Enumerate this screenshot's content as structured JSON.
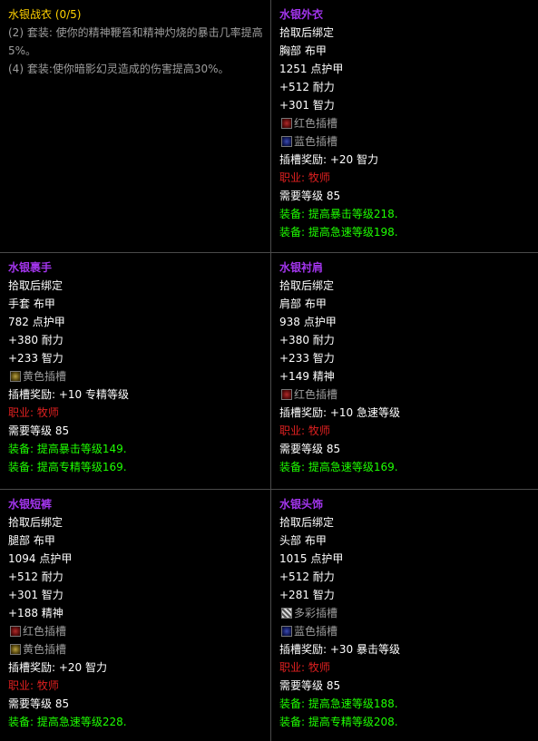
{
  "set_panel": {
    "name": "水银战衣 (0/5)",
    "bonus2": "(2) 套装: 使你的精神鞭笞和精神灼烧的暴击几率提高5%。",
    "bonus4": "(4) 套装:使你暗影幻灵造成的伤害提高30%。"
  },
  "items": [
    {
      "title": "水银外衣",
      "bind": "拾取后绑定",
      "slot": "胸部 布甲",
      "armor": "1251 点护甲",
      "stats": [
        "+512 耐力",
        "+301 智力"
      ],
      "sockets": [
        {
          "color": "red",
          "label": "红色插槽"
        },
        {
          "color": "blue",
          "label": "蓝色插槽"
        }
      ],
      "socket_bonus": "插槽奖励: +20 智力",
      "class": "职业: 牧师",
      "level": "需要等级 85",
      "equips": [
        "装备: 提高暴击等级218.",
        "装备: 提高急速等级198."
      ]
    },
    {
      "title": "水银裹手",
      "bind": "拾取后绑定",
      "slot": "手套 布甲",
      "armor": "782 点护甲",
      "stats": [
        "+380 耐力",
        "+233 智力"
      ],
      "sockets": [
        {
          "color": "yellow",
          "label": "黄色插槽"
        }
      ],
      "socket_bonus": "插槽奖励: +10 专精等级",
      "class": "职业: 牧师",
      "level": "需要等级 85",
      "equips": [
        "装备: 提高暴击等级149.",
        "装备: 提高专精等级169."
      ]
    },
    {
      "title": "水银衬肩",
      "bind": "拾取后绑定",
      "slot": "肩部 布甲",
      "armor": "938 点护甲",
      "stats": [
        "+380 耐力",
        "+233 智力",
        "+149 精神"
      ],
      "sockets": [
        {
          "color": "red",
          "label": "红色插槽"
        }
      ],
      "socket_bonus": "插槽奖励: +10 急速等级",
      "class": "职业: 牧师",
      "level": "需要等级 85",
      "equips": [
        "装备: 提高急速等级169."
      ]
    },
    {
      "title": "水银短裤",
      "bind": "拾取后绑定",
      "slot": "腿部 布甲",
      "armor": "1094 点护甲",
      "stats": [
        "+512 耐力",
        "+301 智力",
        "+188 精神"
      ],
      "sockets": [
        {
          "color": "red",
          "label": "红色插槽"
        },
        {
          "color": "yellow",
          "label": "黄色插槽"
        }
      ],
      "socket_bonus": "插槽奖励: +20 智力",
      "class": "职业: 牧师",
      "level": "需要等级 85",
      "equips": [
        "装备: 提高急速等级228."
      ]
    },
    {
      "title": "水银头饰",
      "bind": "拾取后绑定",
      "slot": "头部 布甲",
      "armor": "1015 点护甲",
      "stats": [
        "+512 耐力",
        "+281 智力"
      ],
      "sockets": [
        {
          "color": "prismatic",
          "label": "多彩插槽"
        },
        {
          "color": "blue",
          "label": "蓝色插槽"
        }
      ],
      "socket_bonus": "插槽奖励: +30 暴击等级",
      "class": "职业: 牧师",
      "level": "需要等级 85",
      "equips": [
        "装备: 提高急速等级188.",
        "装备: 提高专精等级208."
      ]
    }
  ]
}
